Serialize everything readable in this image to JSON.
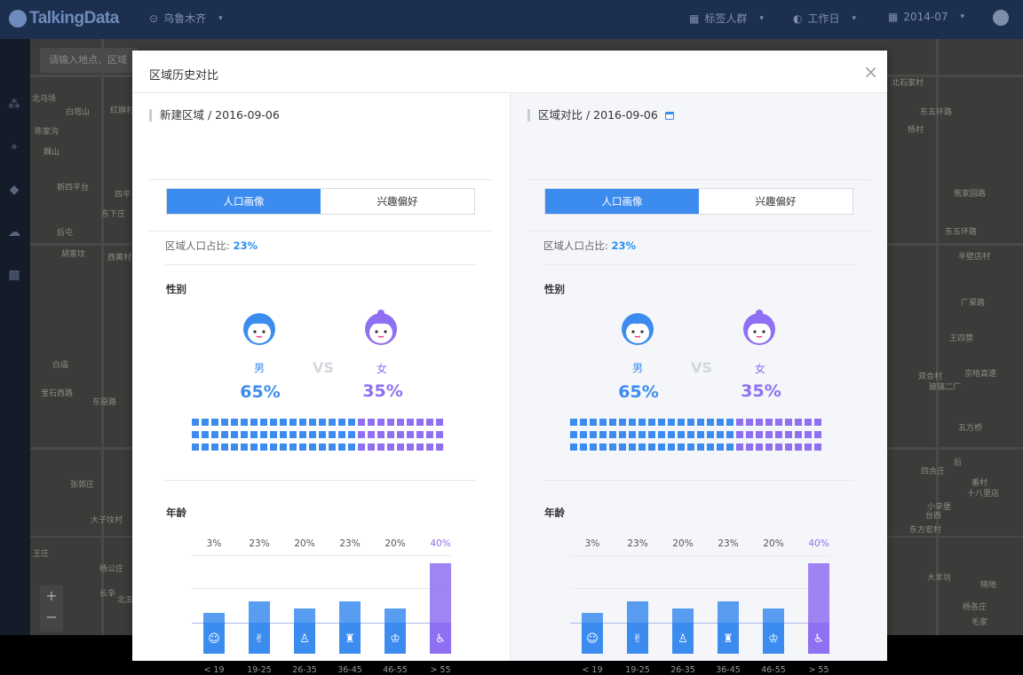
{
  "topbar": {
    "logo": "TalkingData",
    "city": "乌鲁木齐",
    "crowd": "标签人群",
    "day": "工作日",
    "month": "2014-07"
  },
  "map": {
    "search_placeholder": "请输入地点、区域",
    "labels": [
      "北马场",
      "白塔山",
      "红旗村",
      "陈家沟",
      "魏山",
      "新四平台",
      "四平",
      "东下庄",
      "后屯",
      "胡家坟",
      "西黄村",
      "白庙",
      "宝石西路",
      "东原路",
      "张郭庄",
      "大子坟村",
      "王庄",
      "杨公庄",
      "长辛",
      "北五环",
      "北石家村",
      "东五环路",
      "杨村",
      "焦家园路",
      "东五环路",
      "半壁店村",
      "广渠路",
      "王四营",
      "京哈高速",
      "双合村",
      "玻璃二厂",
      "五方桥",
      "四合庄",
      "番村",
      "十八里店",
      "小辛堡",
      "大羊坊",
      "东方宏村",
      "晓地",
      "杨各庄",
      "毛家",
      "后",
      "台西"
    ]
  },
  "modal": {
    "title": "区域历史对比",
    "close_label": "×"
  },
  "panels": [
    {
      "title": "新建区域 / 2016-09-06",
      "tabs": [
        "人口画像",
        "兴趣偏好"
      ],
      "ratio_label": "区域人口占比:",
      "ratio_value": "23%",
      "gender_title": "性别",
      "male_label": "男",
      "female_label": "女",
      "vs": "VS",
      "male_pct": "65%",
      "female_pct": "35%",
      "age_title": "年龄",
      "ages": [
        {
          "label": "< 19",
          "pct": "3%",
          "value": 3
        },
        {
          "label": "19-25",
          "pct": "23%",
          "value": 23
        },
        {
          "label": "26-35",
          "pct": "20%",
          "value": 20
        },
        {
          "label": "36-45",
          "pct": "23%",
          "value": 23
        },
        {
          "label": "46-55",
          "pct": "20%",
          "value": 20
        },
        {
          "label": "> 55",
          "pct": "40%",
          "value": 40
        }
      ]
    },
    {
      "title": "区域对比 / 2016-09-06",
      "tabs": [
        "人口画像",
        "兴趣偏好"
      ],
      "ratio_label": "区域人口占比:",
      "ratio_value": "23%",
      "gender_title": "性别",
      "male_label": "男",
      "female_label": "女",
      "vs": "VS",
      "male_pct": "65%",
      "female_pct": "35%",
      "age_title": "年龄",
      "ages": [
        {
          "label": "< 19",
          "pct": "3%",
          "value": 3
        },
        {
          "label": "19-25",
          "pct": "23%",
          "value": 23
        },
        {
          "label": "26-35",
          "pct": "20%",
          "value": 20
        },
        {
          "label": "36-45",
          "pct": "23%",
          "value": 23
        },
        {
          "label": "46-55",
          "pct": "20%",
          "value": 20
        },
        {
          "label": "> 55",
          "pct": "40%",
          "value": 40
        }
      ]
    }
  ],
  "colors": {
    "male": "#3c8cf0",
    "female": "#8f6ff2",
    "accent": "#2b8ff2"
  }
}
